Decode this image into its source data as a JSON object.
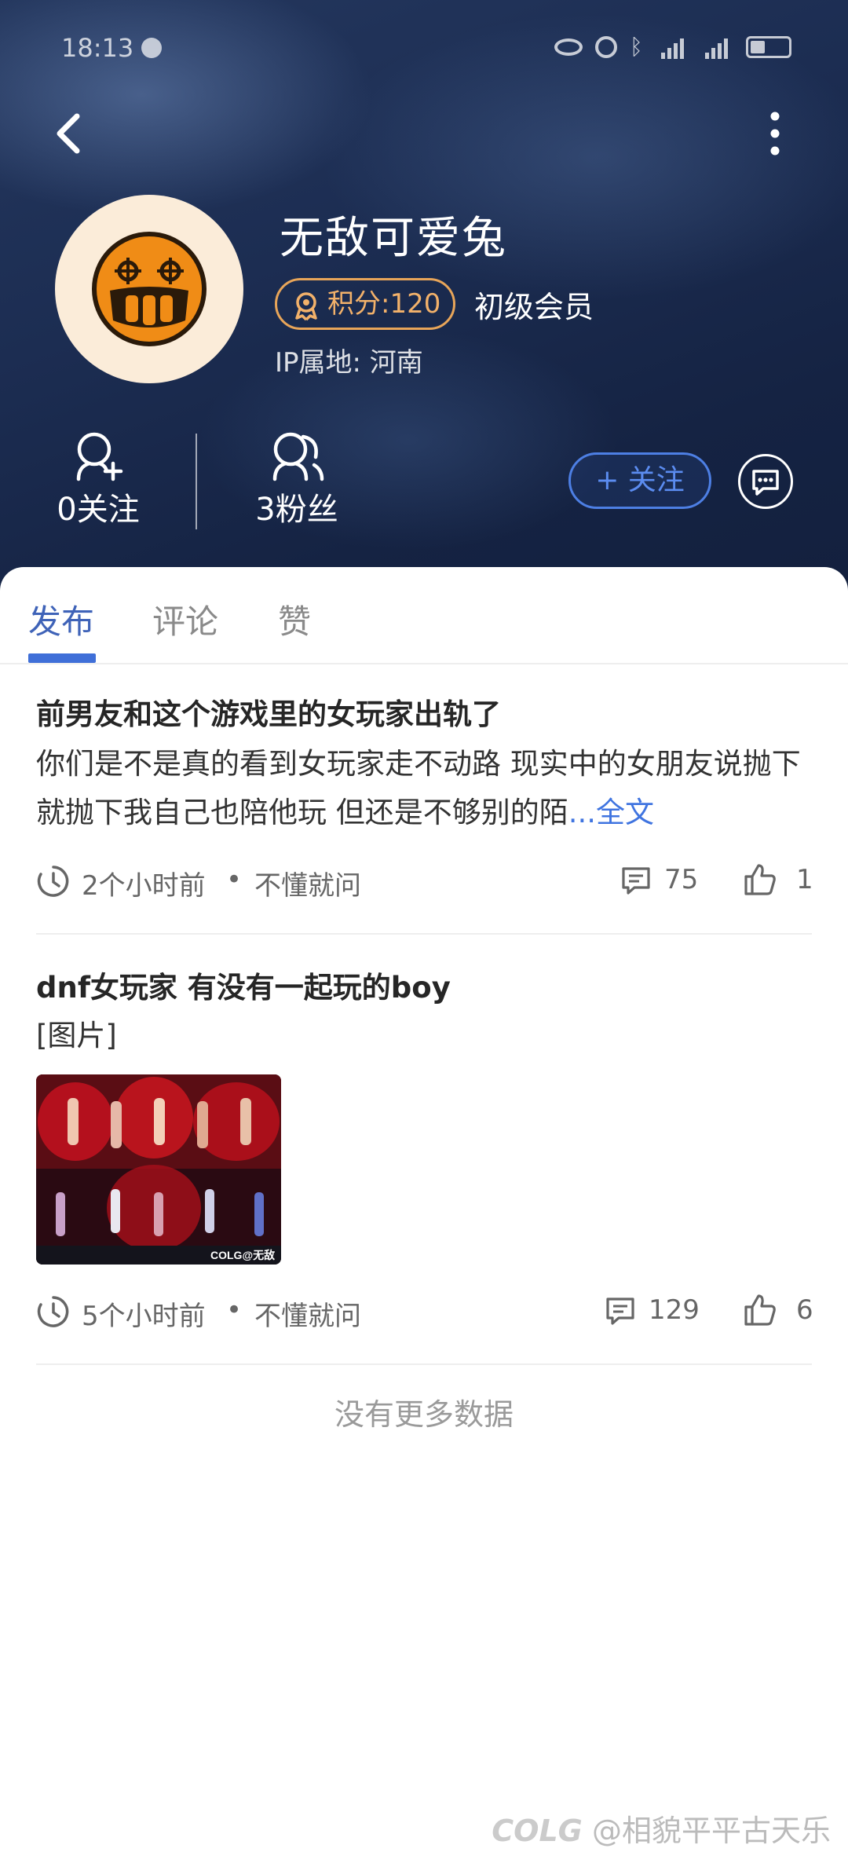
{
  "status_bar": {
    "time": "18:13",
    "network_1": "4G",
    "network_2": "4G"
  },
  "profile": {
    "username": "无敌可爱兔",
    "score_label": "积分:120",
    "member_level": "初级会员",
    "ip_location": "IP属地: 河南"
  },
  "stats": {
    "following": "0关注",
    "fans": "3粉丝"
  },
  "actions": {
    "follow_label": "+ 关注"
  },
  "tabs": [
    {
      "label": "发布"
    },
    {
      "label": "评论"
    },
    {
      "label": "赞"
    }
  ],
  "posts": [
    {
      "title": "前男友和这个游戏里的女玩家出轨了",
      "body": "你们是不是真的看到女玩家走不动路 现实中的女朋友说抛下就抛下我自己也陪他玩 但还是不够别的陌",
      "more": "...全文",
      "time": "2个小时前",
      "category": "不懂就问",
      "comments": "75",
      "likes": "1"
    },
    {
      "title": "dnf女玩家 有没有一起玩的boy",
      "body": "[图片]",
      "image_caption": "COLG@无敌",
      "time": "5个小时前",
      "category": "不懂就问",
      "comments": "129",
      "likes": "6"
    }
  ],
  "footer": {
    "no_more": "没有更多数据"
  },
  "watermark": {
    "logo": "COLG",
    "text": "@相貌平平古天乐"
  },
  "colors": {
    "accent": "#3f6fd8",
    "badge": "#e8a559",
    "header_bg": "#1c2d52"
  }
}
